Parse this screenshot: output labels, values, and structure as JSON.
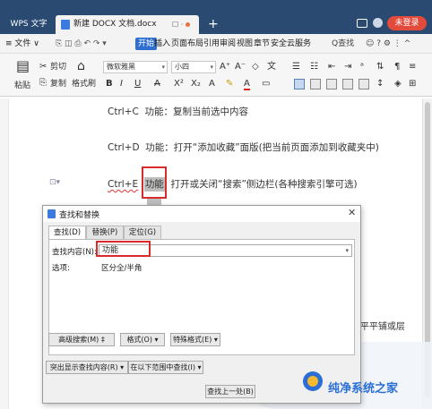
{
  "titlebar": {
    "app_tab": "WPS 文字",
    "doc_tab": "新建 DOCX 文档.docx",
    "doc_tab_icons": "☐ ·",
    "new_tab": "+",
    "login": "未登录"
  },
  "menubar": {
    "file": "≡ 文件 ∨",
    "items": [
      "开始",
      "插入",
      "页面布局",
      "引用",
      "审阅",
      "视图",
      "章节",
      "安全",
      "云服务"
    ],
    "search": "Q查找",
    "colors": {
      "start_bg": "#2f6fd0",
      "titlebar": "#2b4a72",
      "login_bg": "#e24a3b"
    }
  },
  "ribbon": {
    "paste": "粘贴",
    "cut": "剪切",
    "copy": "复制",
    "format_painter": "格式刷",
    "font_name": "微软雅黑",
    "font_size": "小四",
    "font_grow": "A⁺",
    "font_shrink": "A⁻"
  },
  "document": {
    "lines": [
      {
        "key": "Ctrl+C",
        "text": "功能：复制当前选中内容"
      },
      {
        "key": "Ctrl+D",
        "text": "功能：打开“添加收藏”面版(把当前页面添加到收藏夹中)"
      },
      {
        "key": "Ctrl+E",
        "highlight": "功能",
        "text": "打开或关闭“搜索”侧边栏(各种搜索引擎可选)"
      }
    ],
    "partial_text": "(平平铺或层"
  },
  "dialog": {
    "title": "查找和替换",
    "tabs": [
      "查找(D)",
      "替换(P)",
      "定位(G)"
    ],
    "find_label": "查找内容(N):",
    "find_value": "功能",
    "options_label": "选项:",
    "options_value": "区分全/半角",
    "buttons": {
      "advanced": "高级搜索(M) ‡",
      "format": "格式(O) ▾",
      "special": "特殊格式(E) ▾",
      "highlight": "突出显示查找内容(R) ▾",
      "find_in": "在以下范围中查找(I) ▾",
      "find_prev": "查找上一处(B)"
    }
  },
  "watermark": {
    "text": "纯净系统之家"
  }
}
